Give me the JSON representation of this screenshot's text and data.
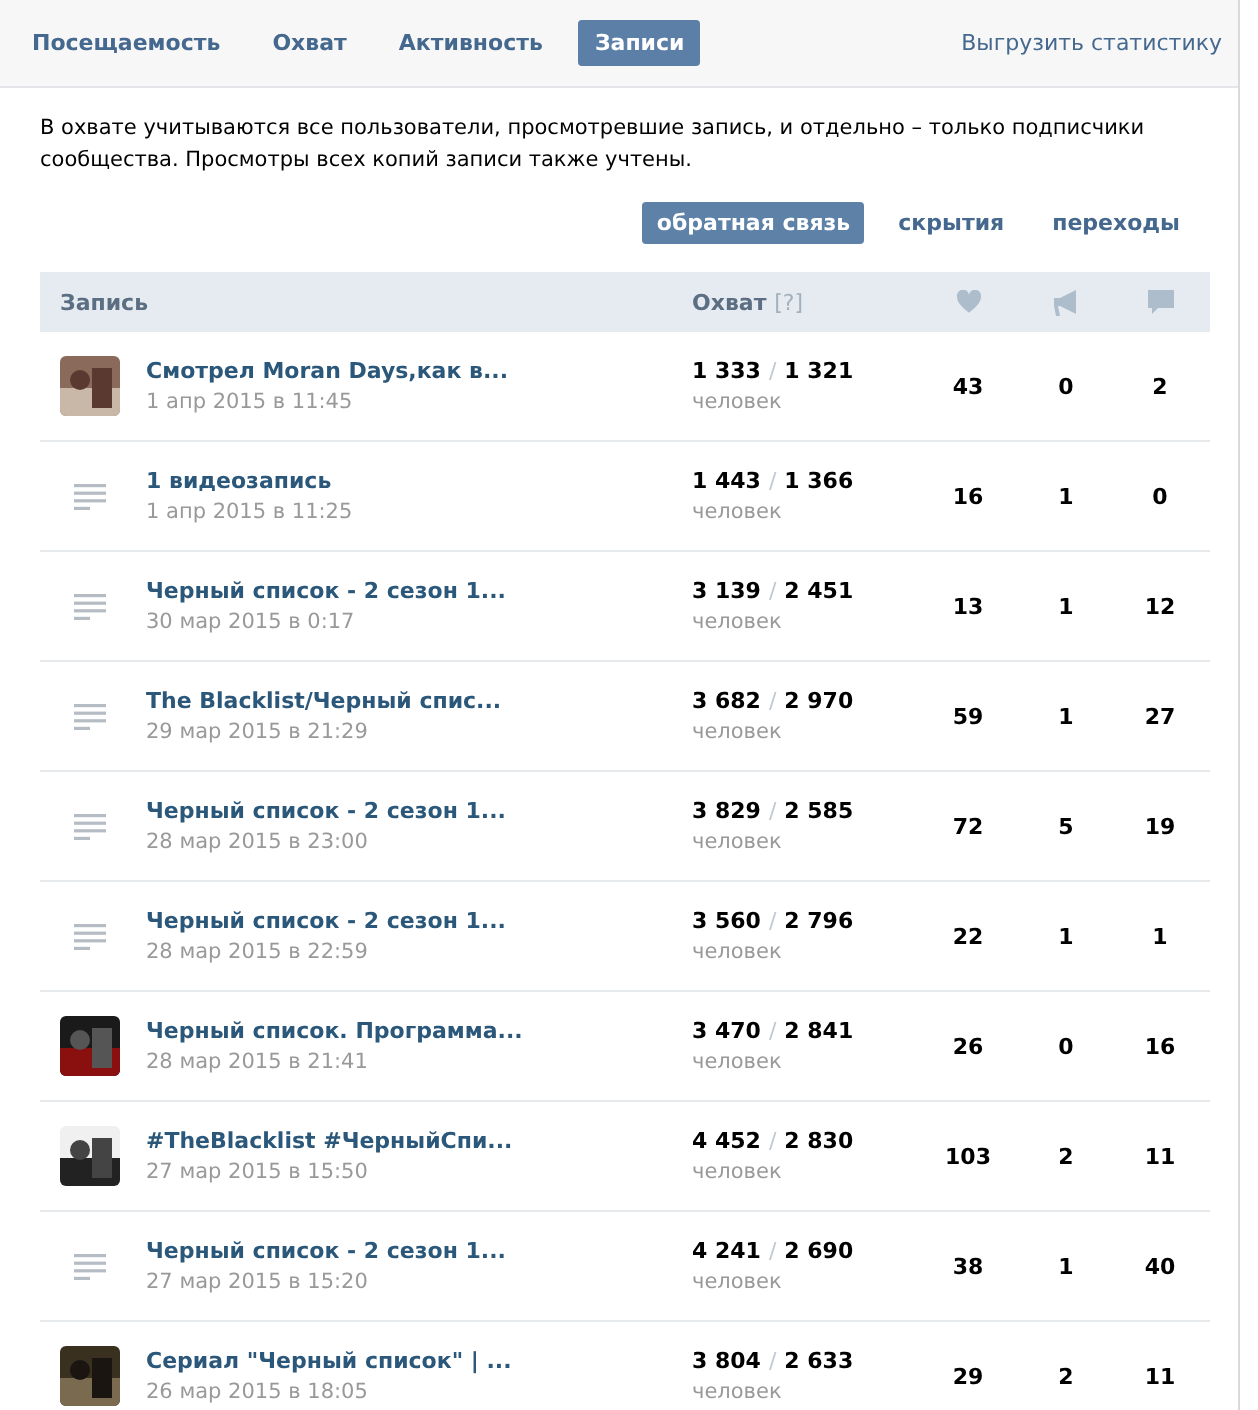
{
  "tabs": [
    {
      "label": "Посещаемость",
      "selected": false
    },
    {
      "label": "Охват",
      "selected": false
    },
    {
      "label": "Активность",
      "selected": false
    },
    {
      "label": "Записи",
      "selected": true
    }
  ],
  "export_link": "Выгрузить статистику",
  "description": "В охвате учитываются все пользователи, просмотревшие запись, и отдельно – только подписчики сообщества. Просмотры всех копий записи также учтены.",
  "subtabs": [
    {
      "label": "обратная связь",
      "selected": true
    },
    {
      "label": "скрытия",
      "selected": false
    },
    {
      "label": "переходы",
      "selected": false
    }
  ],
  "table": {
    "columns": {
      "post": "Запись",
      "reach": "Охват",
      "reach_help": "[?]"
    },
    "rows": [
      {
        "kind": "picture",
        "title": "Смотрел Moran Days,как в...",
        "date": "1 апр 2015 в 11:45",
        "reach_total": "1 333",
        "separator": "/",
        "reach_subscribers": "1 321",
        "unit": "человек",
        "likes": "43",
        "reposts": "0",
        "comments": "2"
      },
      {
        "kind": "text",
        "title": "1 видеозапись",
        "date": "1 апр 2015 в 11:25",
        "reach_total": "1 443",
        "separator": "/",
        "reach_subscribers": "1 366",
        "unit": "человек",
        "likes": "16",
        "reposts": "1",
        "comments": "0"
      },
      {
        "kind": "text",
        "title": "Черный список - 2 сезон 1...",
        "date": "30 мар 2015 в 0:17",
        "reach_total": "3 139",
        "separator": "/",
        "reach_subscribers": "2 451",
        "unit": "человек",
        "likes": "13",
        "reposts": "1",
        "comments": "12"
      },
      {
        "kind": "text",
        "title": "The Blacklist/Черный спис...",
        "date": "29 мар 2015 в 21:29",
        "reach_total": "3 682",
        "separator": "/",
        "reach_subscribers": "2 970",
        "unit": "человек",
        "likes": "59",
        "reposts": "1",
        "comments": "27"
      },
      {
        "kind": "text",
        "title": "Черный список - 2 сезон 1...",
        "date": "28 мар 2015 в 23:00",
        "reach_total": "3 829",
        "separator": "/",
        "reach_subscribers": "2 585",
        "unit": "человек",
        "likes": "72",
        "reposts": "5",
        "comments": "19"
      },
      {
        "kind": "text",
        "title": "Черный список - 2 сезон 1...",
        "date": "28 мар 2015 в 22:59",
        "reach_total": "3 560",
        "separator": "/",
        "reach_subscribers": "2 796",
        "unit": "человек",
        "likes": "22",
        "reposts": "1",
        "comments": "1"
      },
      {
        "kind": "picture",
        "title": "Черный список. Программа...",
        "date": "28 мар 2015 в 21:41",
        "reach_total": "3 470",
        "separator": "/",
        "reach_subscribers": "2 841",
        "unit": "человек",
        "likes": "26",
        "reposts": "0",
        "comments": "16"
      },
      {
        "kind": "picture",
        "title": "#TheBlacklist #ЧерныйСпи...",
        "date": "27 мар 2015 в 15:50",
        "reach_total": "4 452",
        "separator": "/",
        "reach_subscribers": "2 830",
        "unit": "человек",
        "likes": "103",
        "reposts": "2",
        "comments": "11"
      },
      {
        "kind": "text",
        "title": "Черный список - 2 сезон 1...",
        "date": "27 мар 2015 в 15:20",
        "reach_total": "4 241",
        "separator": "/",
        "reach_subscribers": "2 690",
        "unit": "человек",
        "likes": "38",
        "reposts": "1",
        "comments": "40"
      },
      {
        "kind": "picture",
        "title": "Сериал \"Черный список\" | ...",
        "date": "26 мар 2015 в 18:05",
        "reach_total": "3 804",
        "separator": "/",
        "reach_subscribers": "2 633",
        "unit": "человек",
        "likes": "29",
        "reposts": "2",
        "comments": "11"
      }
    ]
  }
}
